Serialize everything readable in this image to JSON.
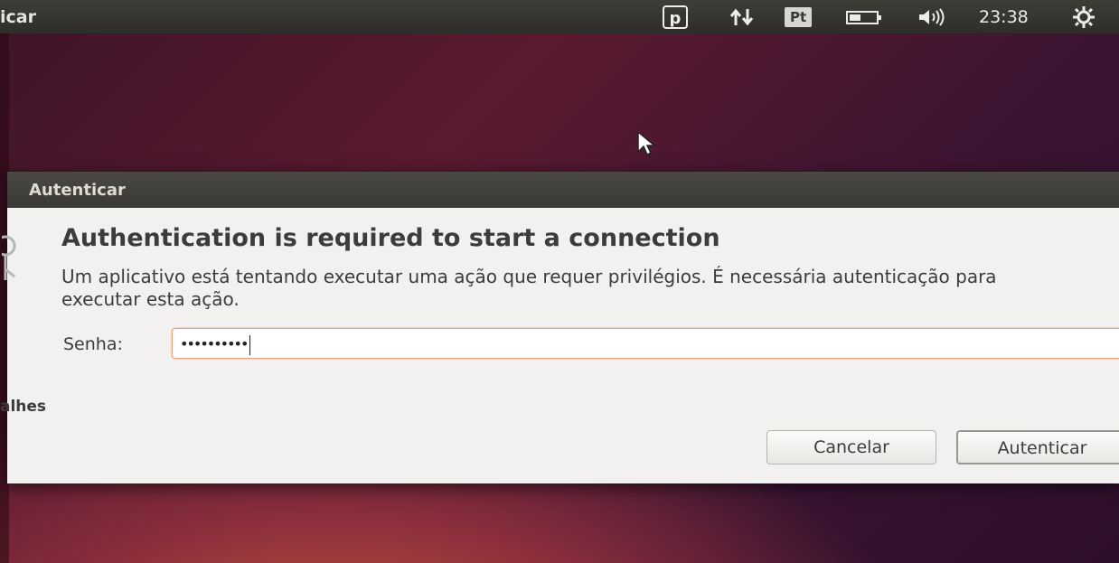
{
  "topbar": {
    "app_title": "icar",
    "tray": {
      "keyboard_layout": "Pt",
      "clock": "23:38"
    }
  },
  "dialog": {
    "title": "Autenticar",
    "heading": "Authentication is required to start a connection",
    "message": "Um aplicativo está tentando executar uma ação que requer privilégios. É necessária autenticação para executar esta ação.",
    "password": {
      "label": "Senha:",
      "value": "••••••••••"
    },
    "details_label": "alhes",
    "buttons": {
      "cancel": "Cancelar",
      "authenticate": "Autenticar"
    }
  }
}
